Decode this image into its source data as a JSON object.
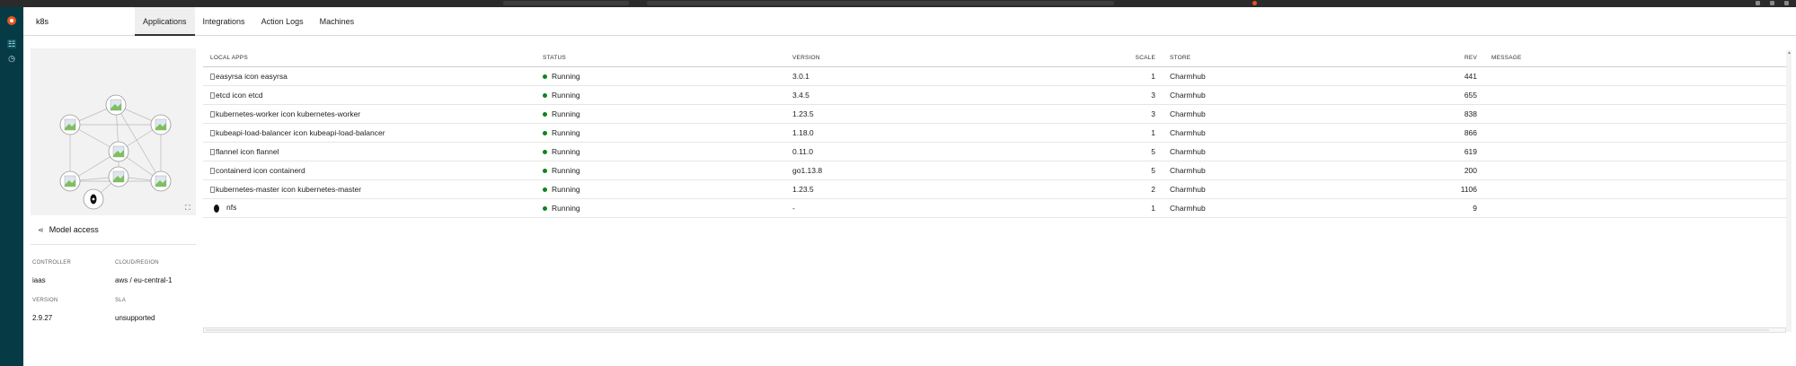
{
  "window": {
    "accent": "#e95420"
  },
  "sidebar": {
    "items": [
      {
        "icon": "juju-logo-icon"
      },
      {
        "icon": "models-icon",
        "active": true
      },
      {
        "icon": "history-icon"
      }
    ],
    "bg": "#063b45"
  },
  "header": {
    "title": "k8s",
    "tabs": [
      {
        "label": "Applications",
        "active": true
      },
      {
        "label": "Integrations"
      },
      {
        "label": "Action Logs"
      },
      {
        "label": "Machines"
      }
    ]
  },
  "model_panel": {
    "model_access_label": "Model access",
    "controller_label": "CONTROLLER",
    "controller_value": "iaas",
    "cloud_label": "CLOUD/REGION",
    "cloud_value": "aws / eu-central-1",
    "version_label": "VERSION",
    "version_value": "2.9.27",
    "sla_label": "SLA",
    "sla_value": "unsupported"
  },
  "apps_table": {
    "columns": [
      "LOCAL APPS",
      "STATUS",
      "VERSION",
      "SCALE",
      "STORE",
      "REV",
      "MESSAGE"
    ],
    "rows": [
      {
        "alt": "easyrsa icon",
        "name": "easyrsa",
        "status": "Running",
        "version": "3.0.1",
        "scale": "1",
        "store": "Charmhub",
        "rev": "441",
        "message": ""
      },
      {
        "alt": "etcd icon",
        "name": "etcd",
        "status": "Running",
        "version": "3.4.5",
        "scale": "3",
        "store": "Charmhub",
        "rev": "655",
        "message": ""
      },
      {
        "alt": "kubernetes-worker icon",
        "name": "kubernetes-worker",
        "status": "Running",
        "version": "1.23.5",
        "scale": "3",
        "store": "Charmhub",
        "rev": "838",
        "message": ""
      },
      {
        "alt": "kubeapi-load-balancer icon",
        "name": "kubeapi-load-balancer",
        "status": "Running",
        "version": "1.18.0",
        "scale": "1",
        "store": "Charmhub",
        "rev": "866",
        "message": ""
      },
      {
        "alt": "flannel icon",
        "name": "flannel",
        "status": "Running",
        "version": "0.11.0",
        "scale": "5",
        "store": "Charmhub",
        "rev": "619",
        "message": ""
      },
      {
        "alt": "containerd icon",
        "name": "containerd",
        "status": "Running",
        "version": "go1.13.8",
        "scale": "5",
        "store": "Charmhub",
        "rev": "200",
        "message": ""
      },
      {
        "alt": "kubernetes-master icon",
        "name": "kubernetes-master",
        "status": "Running",
        "version": "1.23.5",
        "scale": "2",
        "store": "Charmhub",
        "rev": "1106",
        "message": ""
      },
      {
        "alt": "",
        "name": "nfs",
        "status": "Running",
        "version": "-",
        "scale": "1",
        "store": "Charmhub",
        "rev": "9",
        "message": ""
      }
    ],
    "status_color": "#0e8420"
  }
}
